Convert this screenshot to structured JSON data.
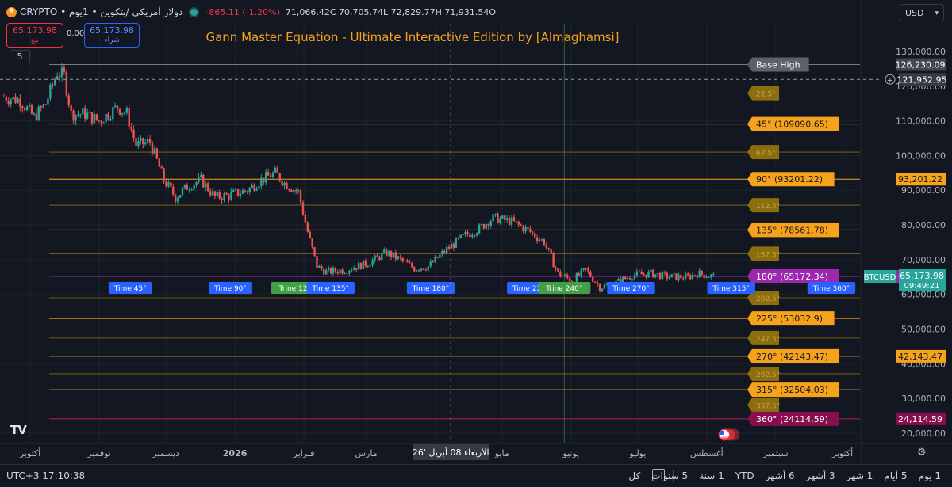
{
  "header": {
    "btc_icon": "B",
    "symbol_line": "دولار أمريكي /بتكوين • 1يوم • CRYPTO",
    "change": "-865.11 (-1.20%)",
    "ohlc": "71,066.42C  70,705.74L  72,829.77H  71,931.54O"
  },
  "trade": {
    "sell_price": "65,173.98",
    "sell_label": "بيع",
    "spread": "0.00",
    "buy_price": "65,173.98",
    "buy_label": "شراء"
  },
  "indicator_count": "5",
  "currency": {
    "label": "USD",
    "chevron": "▾"
  },
  "colors": {
    "bg": "#131722",
    "grid": "#1e222d",
    "up": "#26a69a",
    "down": "#ef5350",
    "orange": "#f7a21b",
    "magenta": "#9c27b0",
    "crimson": "#880e4f",
    "blue": "#2962ff",
    "green": "#43a047",
    "title": "#f7a21b"
  },
  "chart_data": {
    "type": "line",
    "title": "Gann Master Equation - Ultimate Interactive Edition by [Almaghamsi]",
    "y_axis_ticks": [
      130000,
      120000,
      110000,
      100000,
      90000,
      80000,
      70000,
      60000,
      50000,
      40000,
      30000,
      20000
    ],
    "y_axis_tick_labels": [
      "130,000.00",
      "120,000.00",
      "110,000.00",
      "100,000.00",
      "90,000.00",
      "80,000.00",
      "70,000.00",
      "60,000.00",
      "50,000.00",
      "40,000.00",
      "30,000.00",
      "20,000.00"
    ],
    "ylim": [
      17000,
      138000
    ],
    "x_labels": [
      "أكتوبر",
      "نوفمبر",
      "ديسمبر",
      "2026",
      "فبراير",
      "مارس",
      "أبريل",
      "مايو",
      "يونيو",
      "يوليو",
      "أغسطس",
      "سبتمبر",
      "أكتوبر"
    ],
    "x_label_index": [
      0,
      31,
      61,
      92,
      123,
      151,
      182,
      212,
      243,
      273,
      304,
      335,
      365
    ],
    "crosshair_date": "الأربعاء 08 أبريل '26",
    "crosshair_index": 189,
    "crosshair_price": "121,952.95",
    "last_bar_index": 307,
    "price_path": [
      [
        0,
        117000
      ],
      [
        8,
        116000
      ],
      [
        14,
        111000
      ],
      [
        19,
        115000
      ],
      [
        24,
        124000
      ],
      [
        27,
        123000
      ],
      [
        30,
        112000
      ],
      [
        36,
        112000
      ],
      [
        42,
        110000
      ],
      [
        50,
        114000
      ],
      [
        54,
        112000
      ],
      [
        58,
        103000
      ],
      [
        64,
        104000
      ],
      [
        70,
        93000
      ],
      [
        75,
        88000
      ],
      [
        80,
        91000
      ],
      [
        86,
        93000
      ],
      [
        92,
        88000
      ],
      [
        98,
        88500
      ],
      [
        106,
        90000
      ],
      [
        112,
        93000
      ],
      [
        118,
        95000
      ],
      [
        122,
        92000
      ],
      [
        128,
        89500
      ],
      [
        132,
        78000
      ],
      [
        136,
        68000
      ],
      [
        140,
        66500
      ],
      [
        148,
        67000
      ],
      [
        158,
        69000
      ],
      [
        166,
        72000
      ],
      [
        172,
        70000
      ],
      [
        178,
        67500
      ],
      [
        184,
        68000
      ],
      [
        192,
        73000
      ],
      [
        200,
        77000
      ],
      [
        206,
        79000
      ],
      [
        212,
        82000
      ],
      [
        220,
        81000
      ],
      [
        228,
        78000
      ],
      [
        234,
        75000
      ],
      [
        240,
        66000
      ],
      [
        246,
        64000
      ],
      [
        252,
        67000
      ],
      [
        258,
        62000
      ],
      [
        264,
        63000
      ],
      [
        272,
        65500
      ],
      [
        280,
        66000
      ],
      [
        288,
        65000
      ],
      [
        296,
        65000
      ],
      [
        300,
        66000
      ],
      [
        307,
        65174
      ]
    ],
    "gann_levels": [
      {
        "label": "Base High",
        "price": 126230.09,
        "price_label": "126,230.09",
        "style": "base"
      },
      {
        "label": "22.5°",
        "price": 118000,
        "style": "minor"
      },
      {
        "label": "45° (109090.65)",
        "price": 109090.65,
        "style": "major"
      },
      {
        "label": "67.5°",
        "price": 101000,
        "style": "minor"
      },
      {
        "label": "90° (93201.22)",
        "price": 93201.22,
        "price_label": "93,201.22",
        "style": "major"
      },
      {
        "label": "112.5°",
        "price": 85700,
        "style": "minor"
      },
      {
        "label": "135° (78561.78)",
        "price": 78561.78,
        "style": "major"
      },
      {
        "label": "157.5°",
        "price": 71700,
        "style": "minor"
      },
      {
        "label": "180° (65172.34)",
        "price": 65172.34,
        "price_label": "65,172.34",
        "style": "purple"
      },
      {
        "label": "202.5°",
        "price": 59000,
        "style": "minor"
      },
      {
        "label": "225° (53032.9)",
        "price": 53032.9,
        "style": "major"
      },
      {
        "label": "247.5°",
        "price": 47400,
        "style": "minor"
      },
      {
        "label": "270° (42143.47)",
        "price": 42143.47,
        "price_label": "42,143.47",
        "style": "major"
      },
      {
        "label": "292.5°",
        "price": 37100,
        "style": "minor"
      },
      {
        "label": "315° (32504.03)",
        "price": 32504.03,
        "style": "major"
      },
      {
        "label": "337.5°",
        "price": 28100,
        "style": "minor"
      },
      {
        "label": "360° (24114.59)",
        "price": 24114.59,
        "price_label": "24,114.59",
        "style": "crimson"
      }
    ],
    "time_markers": [
      {
        "label": "Time 45°",
        "index": 45,
        "style": "blue"
      },
      {
        "label": "Time 90°",
        "index": 90,
        "style": "blue"
      },
      {
        "label": "Trine 120°",
        "index": 120,
        "style": "green"
      },
      {
        "label": "Time 135°",
        "index": 135,
        "style": "blue"
      },
      {
        "label": "Time 180°",
        "index": 180,
        "style": "blue"
      },
      {
        "label": "Time 225°",
        "index": 225,
        "style": "blue"
      },
      {
        "label": "Trine 240°",
        "index": 240,
        "style": "green"
      },
      {
        "label": "Time 270°",
        "index": 270,
        "style": "blue"
      },
      {
        "label": "Time 315°",
        "index": 315,
        "style": "blue"
      },
      {
        "label": "Time 360°",
        "index": 360,
        "style": "blue"
      }
    ],
    "last_price": {
      "symbol": "BTCUSD",
      "price": 65173.98,
      "price_label": "65,173.98",
      "countdown": "09:49:21"
    }
  },
  "toolbar": {
    "clock": "UTC+3 17:10:38",
    "ranges": [
      "1 يوم",
      "5 أيام",
      "1 شهر",
      "3 أشهر",
      "6 أشهر",
      "YTD",
      "1 سنة",
      "5 سنوات",
      "كل"
    ]
  },
  "logo": "TV",
  "settings_icon": "⚙"
}
